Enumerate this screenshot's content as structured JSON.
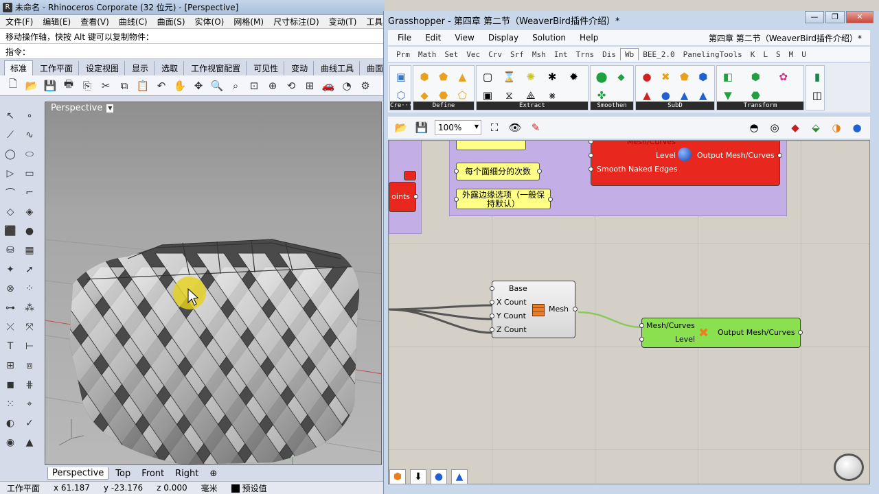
{
  "rhino": {
    "title": "未命名 - Rhinoceros Corporate (32 位元) - [Perspective]",
    "menu": [
      "文件(F)",
      "编辑(E)",
      "查看(V)",
      "曲线(C)",
      "曲面(S)",
      "实体(O)",
      "网格(M)",
      "尺寸标注(D)",
      "变动(T)",
      "工具(L)"
    ],
    "command_history": "移动操作轴，快按 Alt 键可以复制物件：",
    "command_prompt_label": "指令：",
    "command_input": "",
    "toolbar_tabs": [
      "标准",
      "工作平面",
      "设定视图",
      "显示",
      "选取",
      "工作视窗配置",
      "可见性",
      "变动",
      "曲线工具",
      "曲面"
    ],
    "viewport_title": "Perspective",
    "viewport_tabs": [
      "Perspective",
      "Top",
      "Front",
      "Right"
    ],
    "status": {
      "cplane": "工作平面",
      "x": "x 61.187",
      "y": "y -23.176",
      "z": "z 0.000",
      "units": "毫米",
      "layer": "预设值"
    }
  },
  "gh": {
    "title": "Grasshopper - 第四章 第二节（WeaverBird插件介绍）*",
    "menu": [
      "File",
      "Edit",
      "View",
      "Display",
      "Solution",
      "Help"
    ],
    "doc_name": "第四章 第二节（WeaverBird插件介绍）*",
    "category_tabs": [
      "Prm",
      "Math",
      "Set",
      "Vec",
      "Crv",
      "Srf",
      "Msh",
      "Int",
      "Trns",
      "Dis",
      "Wb",
      "BEE_2.0",
      "PanelingTools",
      "K",
      "L",
      "S",
      "M",
      "U"
    ],
    "active_tab": "Wb",
    "ribbon_groups": [
      "Cre···",
      "Define",
      "Extract",
      "Smoothen",
      "SubD",
      "Transform"
    ],
    "zoom": "100%",
    "canvas": {
      "panel_subdiv": "每个面细分的次数",
      "panel_naked": "外露边缘选项（一般保持默认）",
      "red_comp": {
        "in_top": "Mesh/Curves",
        "in_level": "Level",
        "in_smooth": "Smooth Naked Edges",
        "out": "Output Mesh/Curves"
      },
      "red_left_label": "oints",
      "box_comp": {
        "in_base": "Base",
        "in_x": "X Count",
        "in_y": "Y Count",
        "in_z": "Z Count",
        "out": "Mesh"
      },
      "green_comp": {
        "in_mesh": "Mesh/Curves",
        "in_level": "Level",
        "out": "Output Mesh/Curves"
      }
    }
  }
}
